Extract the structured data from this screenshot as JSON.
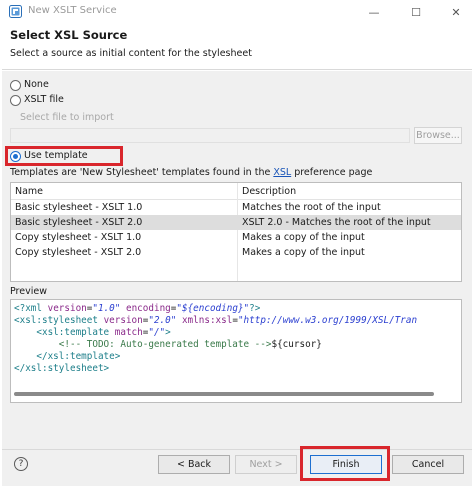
{
  "window": {
    "title": "New XSLT Service",
    "minimize_glyph": "—",
    "maximize_glyph": "☐",
    "close_glyph": "✕"
  },
  "header": {
    "title": "Select XSL Source",
    "description": "Select a source as initial content for the stylesheet"
  },
  "source": {
    "none_label": "None",
    "xslt_file_label": "XSLT file",
    "select_file_label": "Select file to import",
    "browse_label": "Browse...",
    "use_template_label": "Use template",
    "selected": "use_template"
  },
  "templates": {
    "caption_before": "Templates are 'New Stylesheet' templates found in the ",
    "caption_link": "XSL",
    "caption_after": " preference page",
    "columns": [
      "Name",
      "Description"
    ],
    "rows": [
      {
        "name": "Basic stylesheet - XSLT 1.0",
        "description": "Matches the root of the input"
      },
      {
        "name": "Basic stylesheet - XSLT 2.0",
        "description": "XSLT 2.0 - Matches the root of the input"
      },
      {
        "name": "Copy stylesheet - XSLT 1.0",
        "description": "Makes a copy of the input"
      },
      {
        "name": "Copy stylesheet - XSLT 2.0",
        "description": "Makes a copy of the input"
      }
    ],
    "selected_index": 1
  },
  "preview": {
    "label": "Preview",
    "l1_a": "<?xml ",
    "l1_b": "version",
    "l1_c": "=",
    "l1_d": "\"1.0\"",
    "l1_e": " encoding",
    "l1_f": "=",
    "l1_g": "\"${encoding}\"",
    "l1_h": "?>",
    "l2_a": "<xsl:stylesheet ",
    "l2_b": "version",
    "l2_c": "=",
    "l2_d": "\"2.0\"",
    "l2_e": " xmlns:xsl",
    "l2_f": "=",
    "l2_g": "\"http://www.w3.org/1999/XSL/Tran",
    "l3_a": "    <xsl:template ",
    "l3_b": "match",
    "l3_c": "=",
    "l3_d": "\"/\"",
    "l3_e": ">",
    "l4_a": "        <!-- TODO: Auto-generated template -->",
    "l4_b": "${cursor}",
    "l5_a": "    </xsl:template>",
    "l6_a": "</xsl:stylesheet>"
  },
  "buttons": {
    "help": "?",
    "back": "< Back",
    "next": "Next >",
    "finish": "Finish",
    "cancel": "Cancel"
  },
  "colors": {
    "highlight_box": "#d9262c",
    "accent": "#1e6fd0",
    "link": "#1a55b8"
  }
}
